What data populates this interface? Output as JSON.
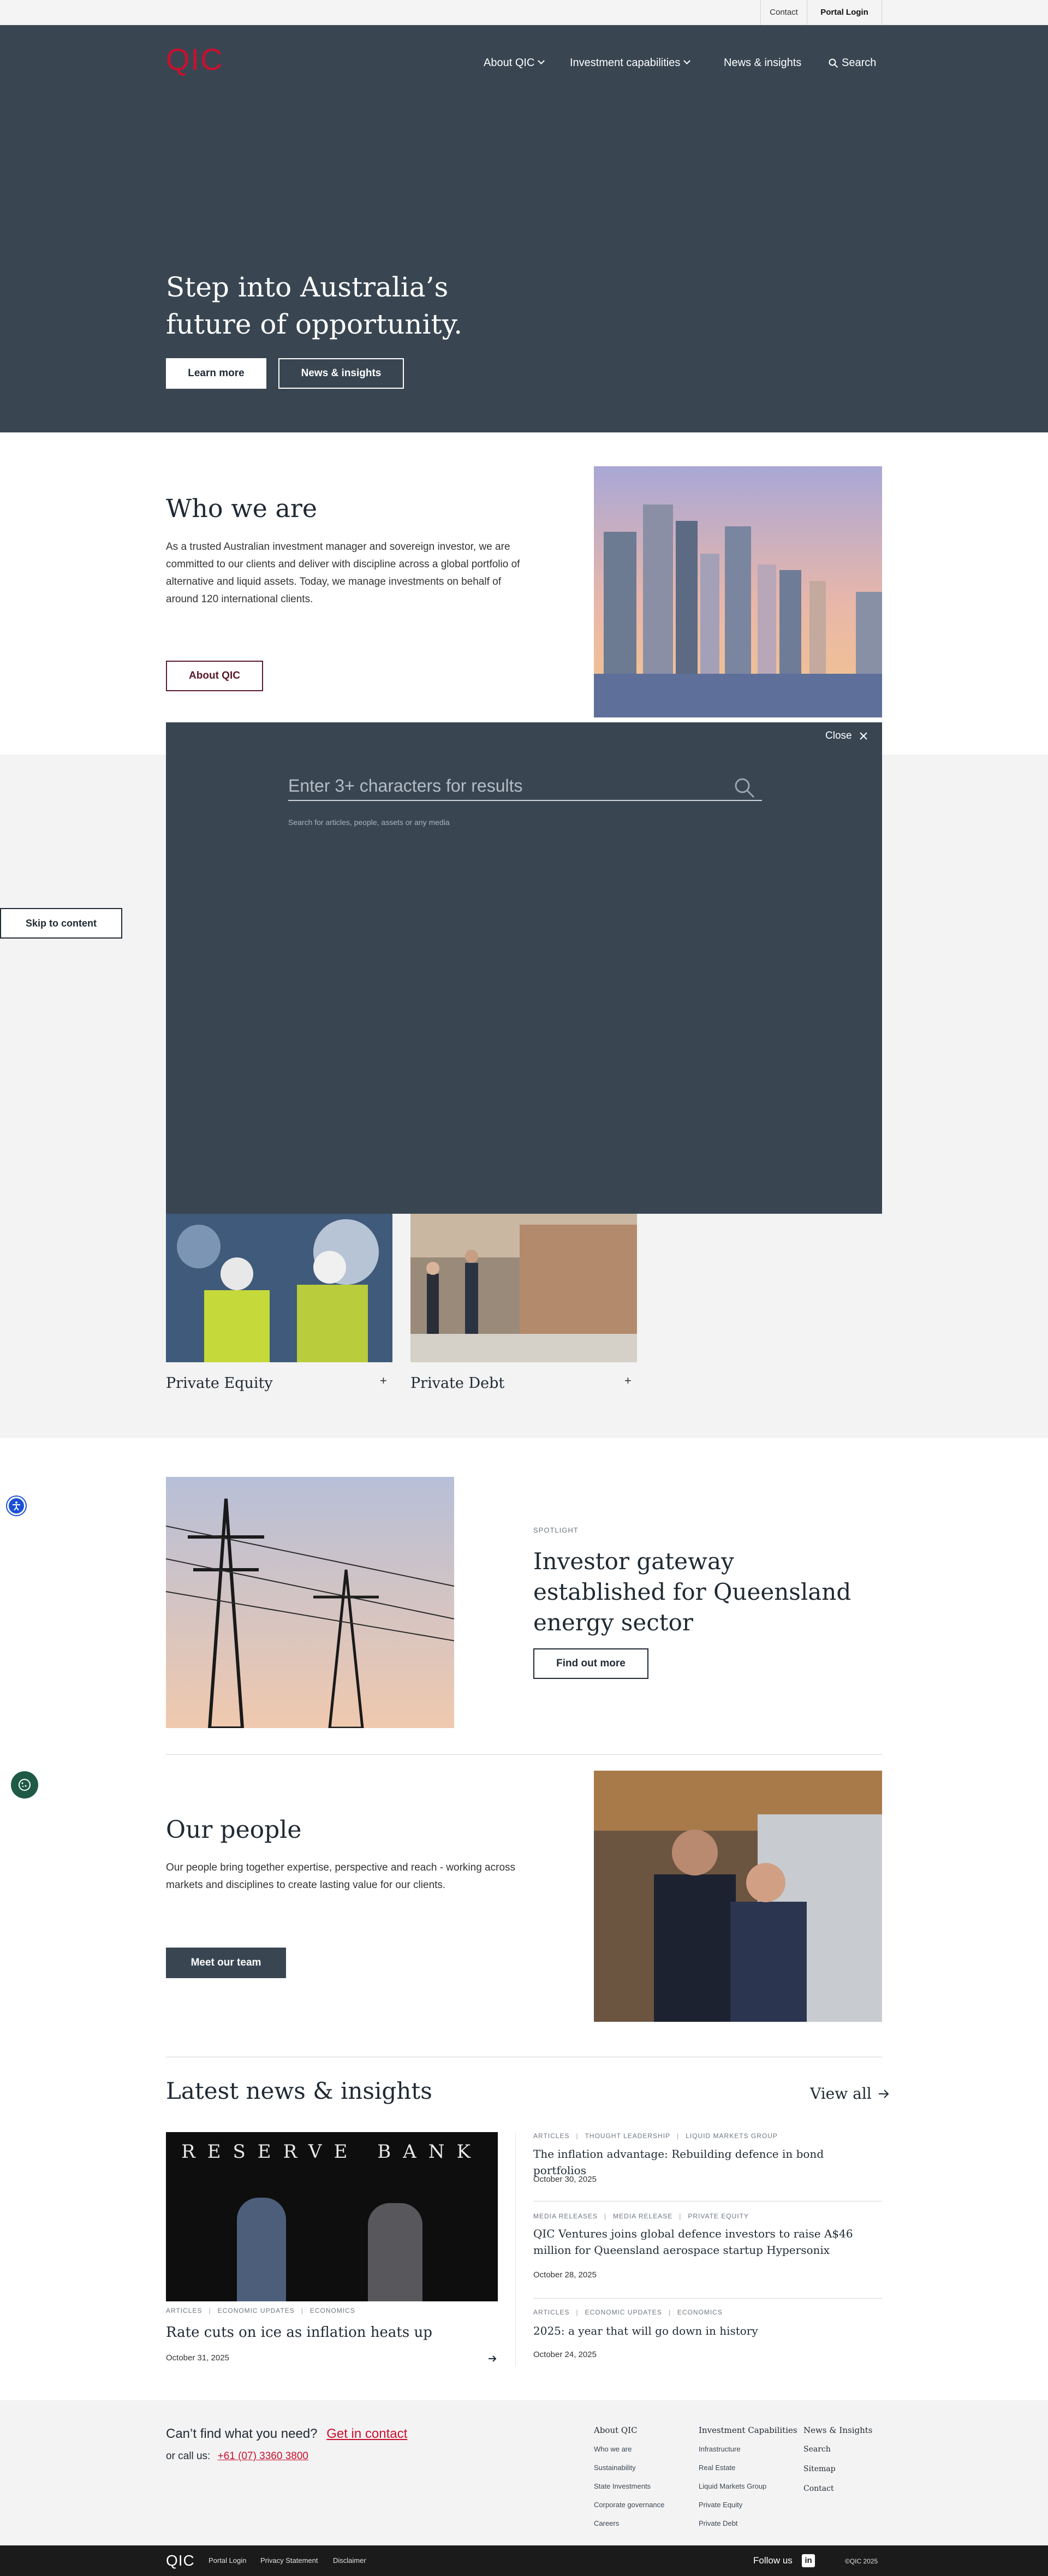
{
  "utility_bar": {
    "contact": "Contact",
    "portal_login": "Portal Login"
  },
  "header": {
    "logo": "QIC",
    "nav": [
      {
        "label": "About QIC",
        "has_dropdown": true
      },
      {
        "label": "Investment capabilities",
        "has_dropdown": true
      },
      {
        "label": "News & insights",
        "has_dropdown": false
      },
      {
        "label": "Search",
        "icon": "search-icon"
      }
    ]
  },
  "hero": {
    "heading": "Step into Australia’s future of opportunity.",
    "primary_button": "Learn more",
    "secondary_button": "News & insights"
  },
  "who_we_are": {
    "heading": "Who we are",
    "body": "As a trusted Australian investment manager and sovereign investor, we are committed to our clients and deliver with discipline across a global portfolio of alternative and liquid assets. Today, we manage investments on behalf of around 120 international clients.",
    "button": "About QIC"
  },
  "search_overlay": {
    "close_label": "Close",
    "placeholder": "Enter 3+ characters for results",
    "hint": "Search for articles, people, assets or any media"
  },
  "skip_link": "Skip to content",
  "capabilities": [
    {
      "label": "Private Equity"
    },
    {
      "label": "Private Debt"
    }
  ],
  "spotlight": {
    "eyebrow": "SPOTLIGHT",
    "heading": "Investor gateway established for Queensland energy sector",
    "button": "Find out more"
  },
  "our_people": {
    "heading": "Our people",
    "body": "Our people bring together expertise, perspective and reach - working across markets and disciplines to create lasting value for our clients.",
    "button": "Meet our team"
  },
  "news": {
    "heading": "Latest news & insights",
    "view_all": "View all",
    "featured": {
      "image_text": "RESERVE BANK",
      "tags": [
        "ARTICLES",
        "ECONOMIC UPDATES",
        "ECONOMICS"
      ],
      "title": "Rate cuts on ice as inflation heats up",
      "date": "October 31, 2025"
    },
    "items": [
      {
        "tags": [
          "ARTICLES",
          "THOUGHT LEADERSHIP",
          "LIQUID MARKETS GROUP"
        ],
        "title": "The inflation advantage: Rebuilding defence in bond portfolios",
        "date": "October 30, 2025"
      },
      {
        "tags": [
          "MEDIA RELEASES",
          "MEDIA RELEASE",
          "PRIVATE EQUITY"
        ],
        "title": "QIC Ventures joins global defence investors to raise A$46 million for Queensland aerospace startup Hypersonix",
        "date": "October 28, 2025"
      },
      {
        "tags": [
          "ARTICLES",
          "ECONOMIC UPDATES",
          "ECONOMICS"
        ],
        "title": "2025: a year that will go down in history",
        "date": "October 24, 2025"
      }
    ]
  },
  "footer": {
    "prompt": "Can’t find what you need?",
    "contact_link": "Get in contact",
    "call_label": "or call us:",
    "phone": "+61 (07) 3360 3800",
    "columns": [
      {
        "heading": "About QIC",
        "links": [
          "Who we are",
          "Sustainability",
          "State Investments",
          "Corporate governance",
          "Careers"
        ]
      },
      {
        "heading": "Investment Capabilities",
        "links": [
          "Infrastructure",
          "Real Estate",
          "Liquid Markets Group",
          "Private Equity",
          "Private Debt"
        ]
      },
      {
        "heading": "News & Insights",
        "links": [
          "Search",
          "Sitemap",
          "Contact"
        ]
      }
    ]
  },
  "bottom_bar": {
    "logo": "QIC",
    "links": [
      "Portal Login",
      "Privacy Statement",
      "Disclaimer"
    ],
    "follow_label": "Follow us",
    "copyright": "©QIC 2025"
  },
  "colors": {
    "brand_red": "#c8102e",
    "navy": "#394652",
    "light_grey": "#f3f3f3",
    "dark": "#1b1b1b"
  }
}
